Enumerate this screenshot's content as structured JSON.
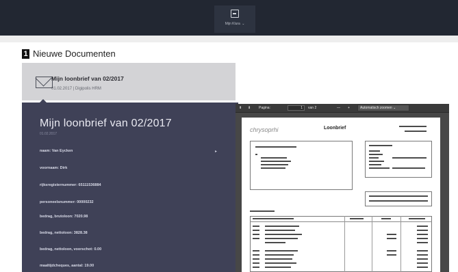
{
  "topbar": {
    "item_label": "Mijn Klura",
    "item_icon": "folder-icon"
  },
  "section": {
    "number": "1",
    "title": "Nieuwe Documenten"
  },
  "document": {
    "icon": "envelope-icon",
    "title": "Mijn loonbrief van 02/2017",
    "meta": "01.02.2017 | Digipolis HRM"
  },
  "detail": {
    "title": "Mijn loonbrief van 02/2017",
    "subtitle": "01.02.2017",
    "fields": [
      "naam: Van Eycken",
      "voornaam: Dirk",
      "rijksregisternummer: 65111536884",
      "personeelsnummer: 00000232",
      "bedrag, brutoloon: 7020.98",
      "bedrag, nettoloon: 3828.38",
      "bedrag, nettoloon, voorschot: 0.00",
      "maaltijdcheques, aantal: 19.00"
    ]
  },
  "pdf_viewer": {
    "page_label": "Pagina:",
    "page_value": "1",
    "page_of": "van 2",
    "zoom_out": "—",
    "zoom_in": "+",
    "zoom_mode": "Automatisch zoomen",
    "doc_logo": "chrysoprhi",
    "doc_title": "Loonbrief"
  }
}
